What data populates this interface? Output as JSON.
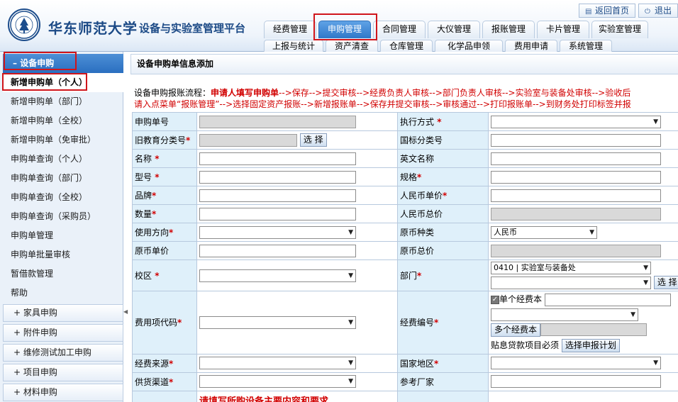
{
  "header": {
    "university": "华东师范大学",
    "platform": "设备与实验室管理平台",
    "top_links": [
      {
        "label": "返回首页",
        "icon": "home-list-icon"
      },
      {
        "label": "退出",
        "icon": "power-icon"
      }
    ],
    "tabs_row1": [
      "经费管理",
      "申购管理",
      "合同管理",
      "大仪管理",
      "报账管理",
      "卡片管理",
      "实验室管理"
    ],
    "tabs_row2": [
      "上报与统计",
      "资产清查",
      "仓库管理",
      "化学品申领",
      "费用申请",
      "系统管理"
    ],
    "active_tab": "申购管理"
  },
  "sidebar": {
    "section_title": "设备申购",
    "items": [
      "新增申购单（个人）",
      "新增申购单（部门）",
      "新增申购单（全校）",
      "新增申购单（免审批）",
      "申购单查询（个人）",
      "申购单查询（部门）",
      "申购单查询（全校）",
      "申购单查询（采购员）",
      "申购单管理",
      "申购单批量审核",
      "暂借款管理",
      "帮助"
    ],
    "groups": [
      "家具申购",
      "附件申购",
      "维修测试加工申购",
      "项目申购",
      "材料申购"
    ]
  },
  "main": {
    "title": "设备申购单信息添加",
    "flow_line1_prefix": "设备申购报账流程：",
    "flow_line1_highlight": "申请人填写申购单",
    "flow_line1_rest": "-->保存-->提交审核-->经费负责人审核-->部门负责人审核-->实验室与装备处审核-->验收后",
    "flow_line2": "请入点菜单“报账管理”-->选择固定资产报账-->新增报账单-->保存并提交审核-->审核通过-->打印报账单-->到财务处打印标签并报",
    "fields": {
      "order_no": "申购单号",
      "exec_method": "执行方式",
      "old_edu_class": "旧教育分类号",
      "select_btn": "选 择",
      "national_class": "国标分类号",
      "name": "名称",
      "english_name": "英文名称",
      "model": "型号",
      "spec": "规格",
      "brand": "品牌",
      "rmb_unit_price": "人民币单价",
      "quantity": "数量",
      "rmb_total": "人民币总价",
      "usage_direction": "使用方向",
      "orig_currency": "原币种类",
      "orig_currency_value": "人民币",
      "orig_unit_price": "原币单价",
      "orig_total": "原币总价",
      "campus": "校区",
      "department": "部门",
      "department_value": "0410 | 实验室与装备处",
      "dept_select_btn": "选 择",
      "expense_code": "费用项代码",
      "fund_no": "经费编号",
      "single_fund": "单个经费本",
      "multi_fund_btn": "多个经费本",
      "loan_note": "贴息贷款项目必须",
      "select_plan_btn": "选择申报计划",
      "fund_source": "经费来源",
      "country": "国家地区",
      "supply_channel": "供货渠道",
      "ref_manufacturer": "参考厂家",
      "requirement_note": "请填写所购设备主要内容和要求"
    }
  }
}
